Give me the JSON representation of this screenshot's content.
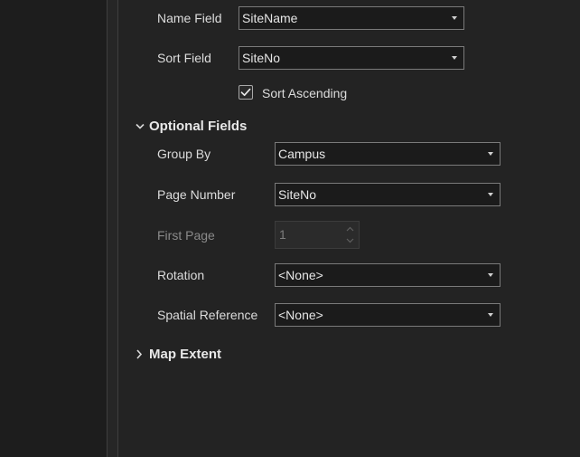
{
  "fields": {
    "name_field": {
      "label": "Name Field",
      "value": "SiteName"
    },
    "sort_field": {
      "label": "Sort Field",
      "value": "SiteNo"
    },
    "sort_ascending": {
      "label": "Sort Ascending",
      "checked": true
    }
  },
  "optional_fields": {
    "header": "Optional Fields",
    "expanded": true,
    "group_by": {
      "label": "Group By",
      "value": "Campus"
    },
    "page_number": {
      "label": "Page Number",
      "value": "SiteNo"
    },
    "first_page": {
      "label": "First Page",
      "value": "1",
      "enabled": false
    },
    "rotation": {
      "label": "Rotation",
      "value": "<None>"
    },
    "spatial_reference": {
      "label": "Spatial Reference",
      "value": "<None>"
    }
  },
  "map_extent": {
    "header": "Map Extent",
    "expanded": false
  },
  "icons": {
    "check": "check-icon",
    "expanded_chevron": "chevron-down-icon",
    "collapsed_chevron": "chevron-right-icon",
    "dropdown_caret": "caret-down-icon"
  },
  "colors": {
    "background": "#232323",
    "control_bg": "#1b1b1b",
    "control_border": "#7a7a7a",
    "text": "#dcdcdc",
    "disabled_text": "#8a8a8a"
  }
}
